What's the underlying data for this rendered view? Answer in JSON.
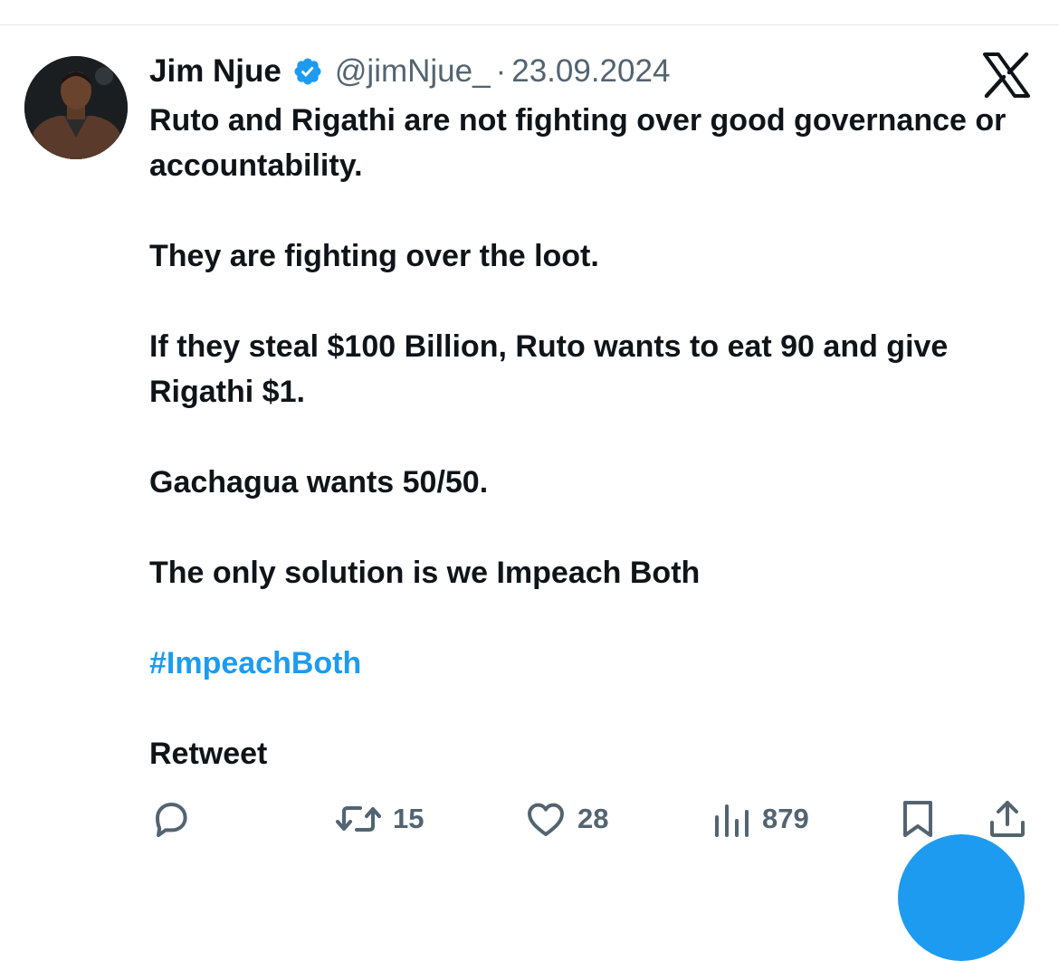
{
  "tweet": {
    "author_name": "Jim Njue",
    "handle": "@jimNjue_",
    "separator": "·",
    "date": "23.09.2024",
    "paragraphs": [
      "Ruto and Rigathi are not fighting over good governance or accountability.",
      "They are fighting over the loot.",
      "If they steal $100 Billion, Ruto wants to eat 90 and give Rigathi $1.",
      "Gachagua wants 50/50.",
      "The only solution is we Impeach Both"
    ],
    "hashtag": "#ImpeachBoth",
    "closing": "Retweet"
  },
  "actions": {
    "reply": {
      "icon": "reply-icon"
    },
    "retweet": {
      "icon": "retweet-icon",
      "count": "15"
    },
    "like": {
      "icon": "heart-icon",
      "count": "28"
    },
    "views": {
      "icon": "views-icon",
      "count": "879"
    },
    "bookmark": {
      "icon": "bookmark-icon"
    },
    "share": {
      "icon": "share-icon"
    }
  },
  "colors": {
    "accent": "#1d9bf0",
    "muted": "#536471",
    "text": "#0f1419"
  }
}
